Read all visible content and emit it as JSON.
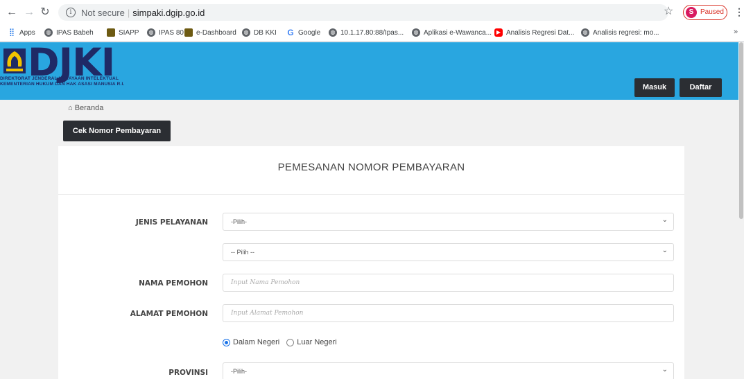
{
  "browser": {
    "security_label": "Not secure",
    "url": "simpaki.dgip.go.id",
    "profile_initial": "S",
    "profile_status": "Paused"
  },
  "bookmarks": [
    {
      "label": "Apps",
      "icon": "apps-grid-icon"
    },
    {
      "label": "IPAS Babeh",
      "icon": "globe-icon"
    },
    {
      "label": "SIAPP",
      "icon": "emblem-icon"
    },
    {
      "label": "IPAS 80",
      "icon": "globe-icon"
    },
    {
      "label": "e-Dashboard",
      "icon": "emblem-icon"
    },
    {
      "label": "DB KKI",
      "icon": "globe-icon"
    },
    {
      "label": "Google",
      "icon": "google-icon"
    },
    {
      "label": "10.1.17.80:88/Ipas...",
      "icon": "globe-icon"
    },
    {
      "label": "Aplikasi e-Wawanca...",
      "icon": "globe-icon"
    },
    {
      "label": "Analisis Regresi Dat...",
      "icon": "youtube-icon"
    },
    {
      "label": "Analisis regresi: mo...",
      "icon": "globe-icon"
    }
  ],
  "header": {
    "logo_text": "DJKI",
    "logo_line1": "DIREKTORAT JENDERAL KEKAYAAN INTELEKTUAL",
    "logo_line2": "KEMENTERIAN HUKUM DAN HAK ASASI MANUSIA R.I.",
    "login_label": "Masuk",
    "register_label": "Daftar"
  },
  "breadcrumb": {
    "home": "Beranda"
  },
  "check_button_label": "Cek Nomor Pembayaran",
  "form": {
    "title": "PEMESANAN NOMOR PEMBAYARAN",
    "service_type_label": "JENIS PELAYANAN",
    "service_type_value": "-Pilih-",
    "sub_service_value": "-- Pilih --",
    "applicant_name_label": "NAMA PEMOHON",
    "applicant_name_placeholder": "Input Nama Pemohon",
    "applicant_address_label": "ALAMAT PEMOHON",
    "applicant_address_placeholder": "Input Alamat Pemohon",
    "origin_options": [
      "Dalam Negeri",
      "Luar Negeri"
    ],
    "origin_selected": "Dalam Negeri",
    "province_label": "PROVINSI",
    "province_value": "-Pilih-"
  },
  "colors": {
    "header_bg": "#29a6e0",
    "logo_navy": "#1f2a66",
    "button_dark": "#2b2e33"
  }
}
